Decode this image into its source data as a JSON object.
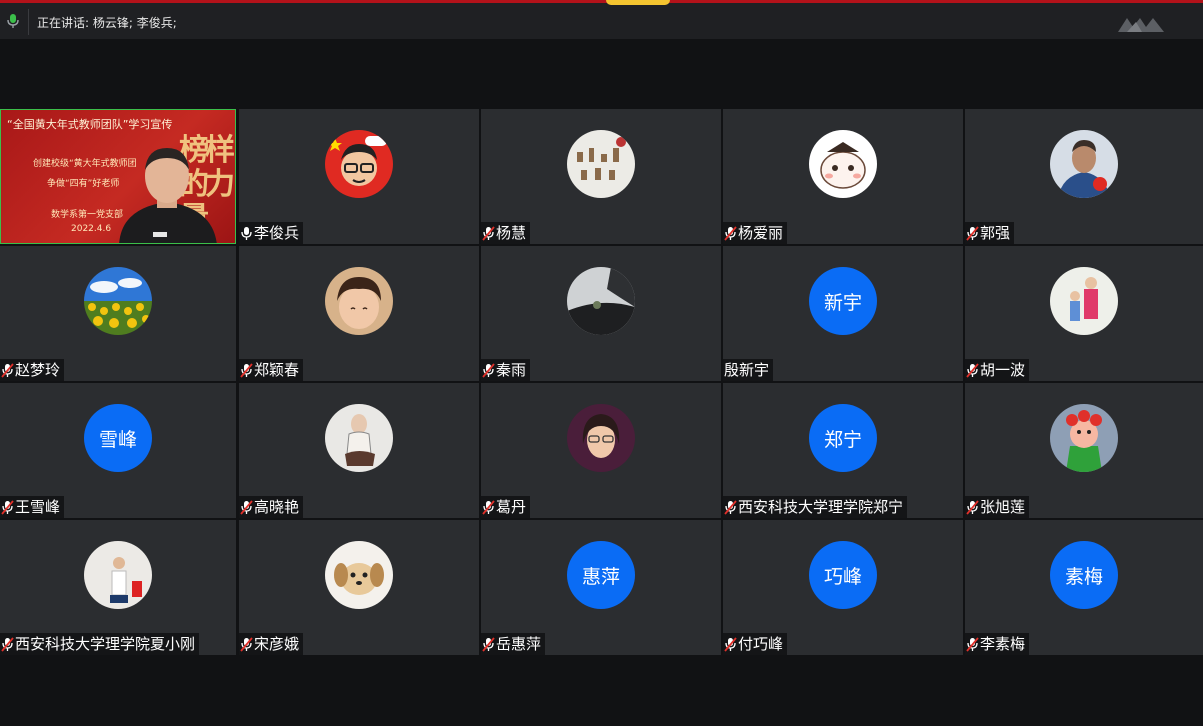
{
  "header": {
    "speaking_text": "正在讲话: 杨云锋; 李俊兵;"
  },
  "presenter_screen": {
    "title": "“全国黄大年式教师团队”学习宣传",
    "line1": "创建校级“黄大年式教师团",
    "line2": "争做“四有”好老师",
    "line3": "数学系第一党支部",
    "date": "2022.4.6",
    "calligraphy": "榜样的力量"
  },
  "participants": [
    {
      "name": "李俊兵",
      "avatar": "cartoon-boy-avatar",
      "mic": "on"
    },
    {
      "name": "杨慧",
      "avatar": "objects-photo-avatar",
      "mic": "muted"
    },
    {
      "name": "杨爱丽",
      "avatar": "cartoon-cat-avatar",
      "mic": "muted"
    },
    {
      "name": "郭强",
      "avatar": "man-photo-avatar",
      "mic": "muted"
    },
    {
      "name": "赵梦玲",
      "avatar": "sunflower-field-avatar",
      "mic": "muted"
    },
    {
      "name": "郑颖春",
      "avatar": "child-photo-avatar",
      "mic": "muted"
    },
    {
      "name": "秦雨",
      "avatar": "car-interior-avatar",
      "mic": "muted"
    },
    {
      "name": "殷新宇",
      "initials": "新宇",
      "mic": "none"
    },
    {
      "name": "胡一波",
      "avatar": "family-photo-avatar",
      "mic": "muted"
    },
    {
      "name": "王雪峰",
      "initials": "雪峰",
      "mic": "muted"
    },
    {
      "name": "高晓艳",
      "avatar": "woman-sketch-avatar",
      "mic": "muted"
    },
    {
      "name": "葛丹",
      "avatar": "woman-photo-avatar",
      "mic": "muted"
    },
    {
      "name": "西安科技大学理学院郑宁",
      "initials": "郑宁",
      "mic": "muted"
    },
    {
      "name": "张旭莲",
      "avatar": "cartoon-doll-avatar",
      "mic": "muted"
    },
    {
      "name": "西安科技大学理学院夏小刚",
      "avatar": "speaker-photo-avatar",
      "mic": "muted"
    },
    {
      "name": "宋彦娥",
      "avatar": "puppy-photo-avatar",
      "mic": "muted"
    },
    {
      "name": "岳惠萍",
      "initials": "惠萍",
      "mic": "muted"
    },
    {
      "name": "付巧峰",
      "initials": "巧峰",
      "mic": "muted"
    },
    {
      "name": "李素梅",
      "initials": "素梅",
      "mic": "muted"
    }
  ],
  "colors": {
    "accent": "#0a6cf5",
    "active_border": "#3bbf4a",
    "mute_red": "#e0302a",
    "top_stripe": "#b3121a"
  }
}
